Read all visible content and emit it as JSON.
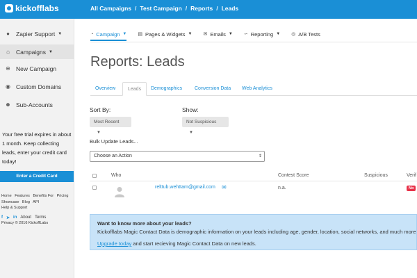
{
  "brand": {
    "name": "kickofflabs"
  },
  "breadcrumbs": [
    "All Campaigns",
    "Test Campaign",
    "Reports",
    "Leads"
  ],
  "sidebar": {
    "account": "Zapier Support",
    "items": [
      {
        "label": "Campaigns",
        "icon": "home-icon"
      },
      {
        "label": "New Campaign",
        "icon": "plus-circle-icon"
      },
      {
        "label": "Custom Domains",
        "icon": "globe-icon"
      },
      {
        "label": "Sub-Accounts",
        "icon": "users-icon"
      }
    ],
    "trial_text": "Your free trial expires in about 1 month. Keep collecting leads, enter your credit card today!",
    "credit_card_button": "Enter a Credit Card",
    "footer_links": [
      "Home",
      "Features",
      "Benefits For",
      "Pricing",
      "Showcase",
      "Blog",
      "API",
      "Help & Support"
    ],
    "social_links": [
      "About",
      "Terms",
      "Privacy"
    ],
    "copyright": "© 2016 KickoffLabs"
  },
  "subnav": [
    {
      "label": "Campaign",
      "icon": "gauge-icon",
      "dropdown": true
    },
    {
      "label": "Pages & Widgets",
      "icon": "file-icon",
      "dropdown": true
    },
    {
      "label": "Emails",
      "icon": "envelope-icon",
      "dropdown": true
    },
    {
      "label": "Reporting",
      "icon": "chart-icon",
      "dropdown": true
    },
    {
      "label": "A/B Tests",
      "icon": "target-icon",
      "dropdown": false
    }
  ],
  "page_title": "Reports: Leads",
  "tabs": [
    "Overview",
    "Leads",
    "Demographics",
    "Conversion Data",
    "Web Analytics"
  ],
  "filters": {
    "sort_label": "Sort By:",
    "sort_value": "Most Recent",
    "show_label": "Show:",
    "show_value": "Not Suspicious"
  },
  "bulk": {
    "label": "Bulk Update Leads...",
    "action_value": "Choose an Action"
  },
  "table": {
    "columns": [
      "Who",
      "Contest Score",
      "Suspicious",
      "Verif"
    ],
    "rows": [
      {
        "email": "relttub.wehttam@gmail.com",
        "contest_score": "n.a.",
        "verified": "No"
      }
    ]
  },
  "info": {
    "heading": "Want to know more about your leads?",
    "body": "Kickofflabs Magic Contact Data is demographic information on your leads including age, gender, location, social networks, and much more",
    "link": "Upgrade today",
    "tail": "and start recieving Magic Contact Data on new leads."
  },
  "colors": {
    "brand_blue": "#1a8fd6",
    "info_bg": "#c8e3f8",
    "badge_red": "#e8334a"
  }
}
